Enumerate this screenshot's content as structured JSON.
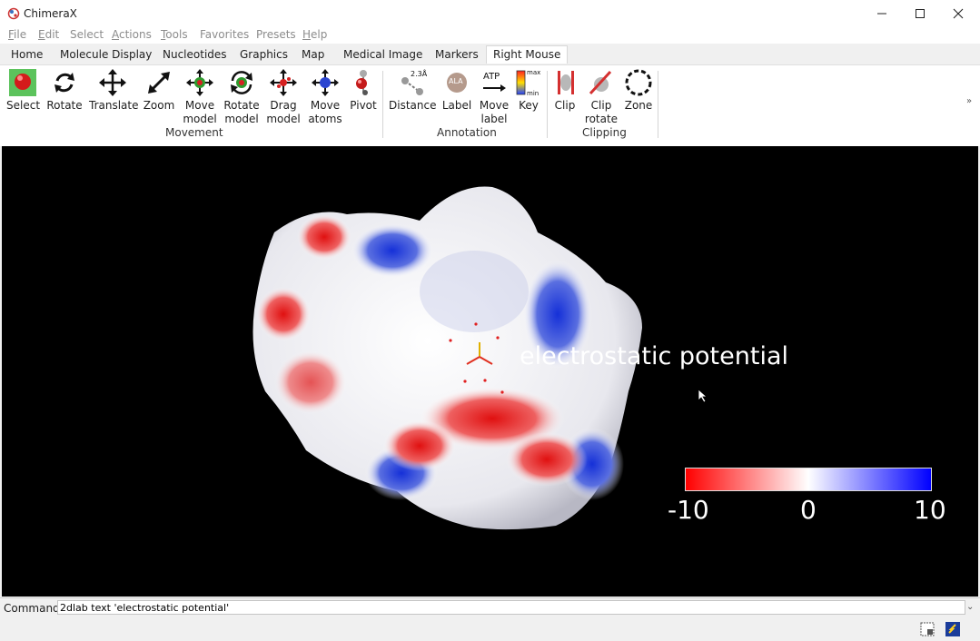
{
  "window": {
    "title": "ChimeraX"
  },
  "menubar": {
    "items": [
      {
        "accel": "F",
        "rest": "ile"
      },
      {
        "accel": "E",
        "rest": "dit"
      },
      {
        "accel": "",
        "rest": "Select"
      },
      {
        "accel": "A",
        "rest": "ctions"
      },
      {
        "accel": "T",
        "rest": "ools"
      },
      {
        "accel": "",
        "rest": "Favorites"
      },
      {
        "accel": "",
        "rest": "Presets"
      },
      {
        "accel": "H",
        "rest": "elp"
      }
    ]
  },
  "tabs": [
    "Home",
    "Molecule Display",
    "Nucleotides",
    "Graphics",
    "Map",
    "Medical Image",
    "Markers",
    "Right Mouse"
  ],
  "active_tab": "Right Mouse",
  "toolbar": {
    "tools": [
      {
        "label1": "Select",
        "label2": "",
        "icon": "select-red-ball-icon"
      },
      {
        "label1": "Rotate",
        "label2": "",
        "icon": "rotate-arrows-icon"
      },
      {
        "label1": "Translate",
        "label2": "",
        "icon": "translate-cross-arrows-icon"
      },
      {
        "label1": "Zoom",
        "label2": "",
        "icon": "zoom-diagonal-arrows-icon"
      },
      {
        "label1": "Move",
        "label2": "model",
        "icon": "move-model-icon"
      },
      {
        "label1": "Rotate",
        "label2": "model",
        "icon": "rotate-model-icon"
      },
      {
        "label1": "Drag",
        "label2": "model",
        "icon": "drag-model-icon"
      },
      {
        "label1": "Move",
        "label2": "atoms",
        "icon": "move-atoms-icon"
      },
      {
        "label1": "Pivot",
        "label2": "",
        "icon": "pivot-icon"
      },
      {
        "label1": "Distance",
        "label2": "",
        "icon": "distance-icon",
        "glyph": "2.3Å"
      },
      {
        "label1": "Label",
        "label2": "",
        "icon": "label-icon",
        "glyph": "ALA"
      },
      {
        "label1": "Move",
        "label2": "label",
        "icon": "move-label-icon",
        "glyph": "ATP"
      },
      {
        "label1": "Key",
        "label2": "",
        "icon": "color-key-icon",
        "glyph_max": "max",
        "glyph_min": "min"
      },
      {
        "label1": "Clip",
        "label2": "",
        "icon": "clip-icon"
      },
      {
        "label1": "Clip",
        "label2": "rotate",
        "icon": "clip-rotate-icon"
      },
      {
        "label1": "Zone",
        "label2": "",
        "icon": "zone-icon"
      }
    ],
    "groups": [
      "Movement",
      "Annotation",
      "Clipping"
    ]
  },
  "graphics": {
    "label_2d": "electrostatic potential",
    "color_key": {
      "min_label": "-10",
      "mid_label": "0",
      "max_label": "10",
      "colors": [
        "#ff0000",
        "#ffffff",
        "#0000ff"
      ]
    }
  },
  "command": {
    "label": "Command:",
    "value": "2dlab text 'electrostatic potential'"
  },
  "colors": {
    "accent_tab": "#ffffff",
    "background": "#000000"
  }
}
